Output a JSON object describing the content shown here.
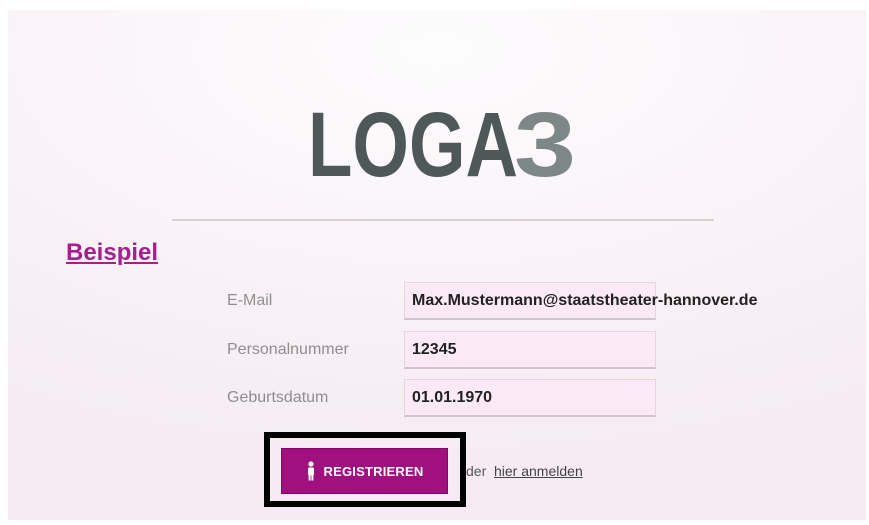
{
  "logo": {
    "text": "LOGA3",
    "letters": "LOGA",
    "digit": "3",
    "color_main": "#4f5859",
    "color_digit": "#7e8788"
  },
  "heading": "Beispiel",
  "form": {
    "email": {
      "label": "E-Mail",
      "value": "Max.Mustermann@staatstheater-hannover.de"
    },
    "personalnummer": {
      "label": "Personalnummer",
      "value": "12345"
    },
    "geburtsdatum": {
      "label": "Geburtsdatum",
      "value": "01.01.1970"
    }
  },
  "actions": {
    "register_label": "REGISTRIEREN",
    "register_icon": "person-icon",
    "or_text": "der",
    "login_link": "hier anmelden"
  },
  "colors": {
    "accent": "#a0117f",
    "heading": "#a51f8e",
    "field_bg": "#fbeaf5",
    "highlight_frame": "#000000"
  }
}
